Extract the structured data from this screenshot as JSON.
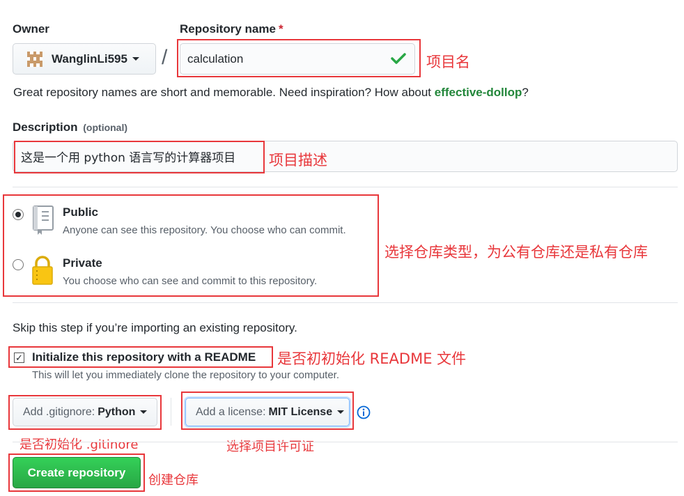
{
  "owner": {
    "label": "Owner",
    "username": "WanglinLi595"
  },
  "repo_name": {
    "label": "Repository name",
    "required_mark": "*",
    "value": "calculation"
  },
  "name_hint": {
    "prefix": "Great repository names are short and memorable. Need inspiration? How about ",
    "suggestion": "effective-dollop",
    "suffix": "?"
  },
  "description": {
    "label": "Description",
    "optional": "(optional)",
    "value": "这是一个用 python 语言写的计算器项目"
  },
  "visibility": {
    "public": {
      "title": "Public",
      "subtitle": "Anyone can see this repository. You choose who can commit.",
      "selected": true
    },
    "private": {
      "title": "Private",
      "subtitle": "You choose who can see and commit to this repository.",
      "selected": false
    }
  },
  "skip_note": "Skip this step if you’re importing an existing repository.",
  "readme": {
    "label": "Initialize this repository with a README",
    "hint": "This will let you immediately clone the repository to your computer.",
    "checked": true,
    "check_glyph": "✓"
  },
  "gitignore": {
    "prefix": "Add .gitignore:",
    "value": "Python"
  },
  "license": {
    "prefix": "Add a license:",
    "value": "MIT License"
  },
  "create_button": "Create repository",
  "annotations": {
    "repo_name": "项目名",
    "description": "项目描述",
    "visibility": "选择仓库类型，为公有仓库还是私有仓库",
    "readme": "是否初初始化 README 文件",
    "gitignore": "是否初始化 .gitinore",
    "license": "选择项目许可证",
    "create": "创建仓库"
  },
  "colors": {
    "annotation_red": "#e8373b",
    "accent_green": "#28a745",
    "suggestion_green": "#22863a",
    "info_blue": "#0366d6"
  },
  "icons": {
    "avatar": "pixel-avatar-icon",
    "valid": "check-icon",
    "public": "book-icon",
    "private": "lock-icon",
    "info": "info-icon"
  }
}
